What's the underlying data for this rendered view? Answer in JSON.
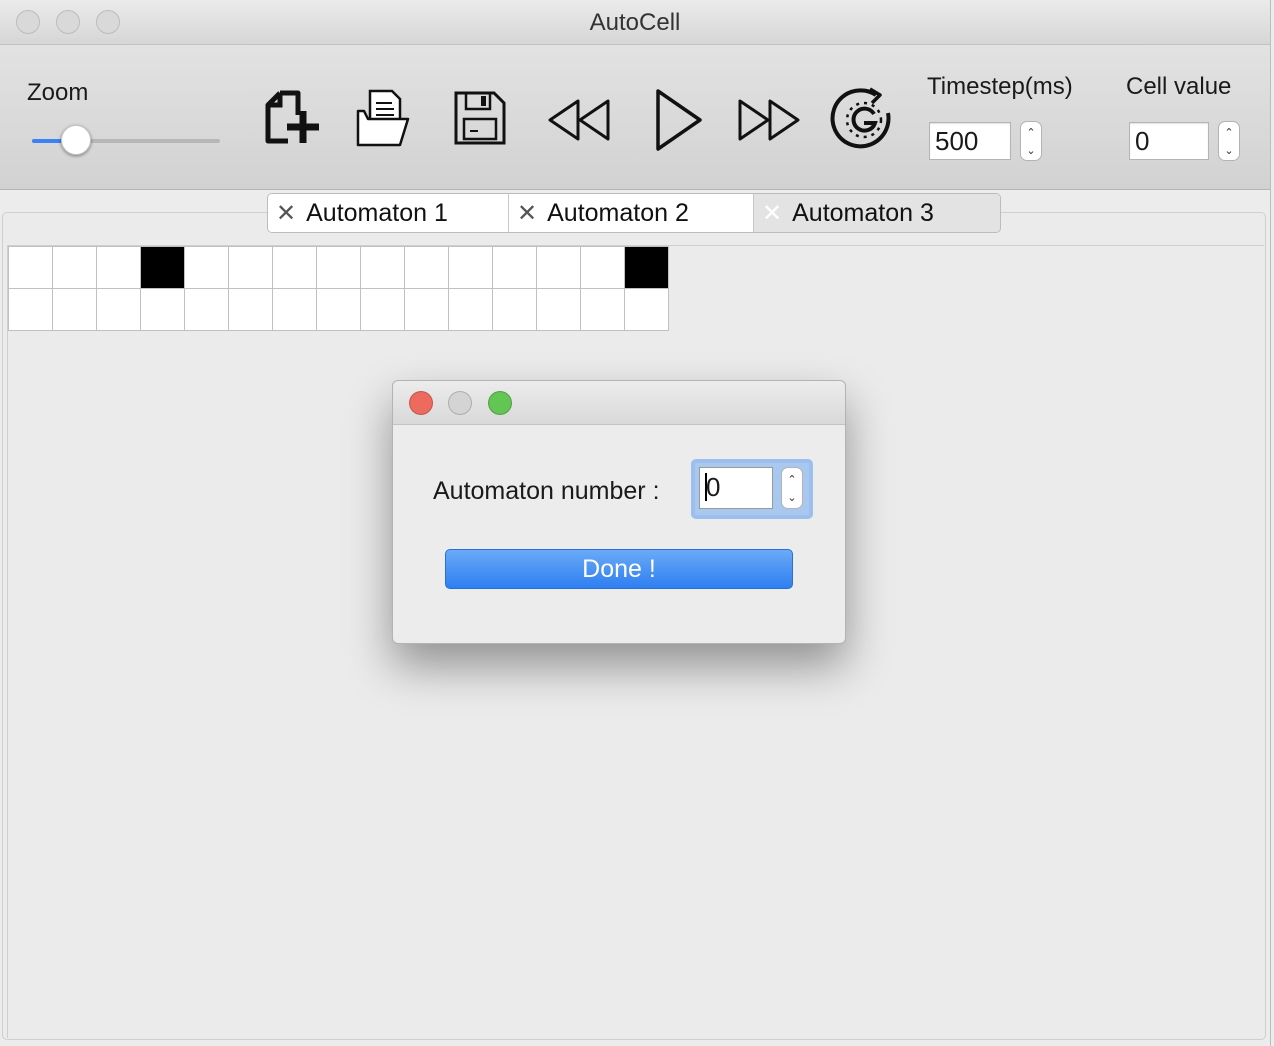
{
  "window": {
    "title": "AutoCell"
  },
  "toolbar": {
    "zoom_label": "Zoom",
    "zoom_level": 0.24,
    "timestep_label": "Timestep(ms)",
    "timestep_value": "500",
    "cell_value_label": "Cell value",
    "cell_value": "0",
    "buttons": [
      {
        "name": "new-file-icon"
      },
      {
        "name": "open-file-icon"
      },
      {
        "name": "save-icon"
      },
      {
        "name": "rewind-icon"
      },
      {
        "name": "play-icon"
      },
      {
        "name": "fast-forward-icon"
      },
      {
        "name": "generate-icon"
      }
    ]
  },
  "tabs": [
    {
      "label": "Automaton 1",
      "close_icon": "close-icon"
    },
    {
      "label": "Automaton 2",
      "close_icon": "close-icon"
    },
    {
      "label": "Automaton 3",
      "close_icon": "close-icon"
    }
  ],
  "grid": {
    "columns": 15,
    "rows": [
      [
        0,
        0,
        0,
        1,
        0,
        0,
        0,
        0,
        0,
        0,
        0,
        0,
        0,
        0,
        1
      ],
      [
        0,
        0,
        0,
        0,
        0,
        0,
        0,
        0,
        0,
        0,
        0,
        0,
        0,
        0,
        0
      ]
    ]
  },
  "dialog": {
    "label": "Automaton number :",
    "value": "0",
    "done_label": "Done !"
  },
  "colors": {
    "close": "#ed6a5e",
    "minimize": "#d4d4d4",
    "zoom": "#62c554",
    "accent": "#3b82f6"
  }
}
